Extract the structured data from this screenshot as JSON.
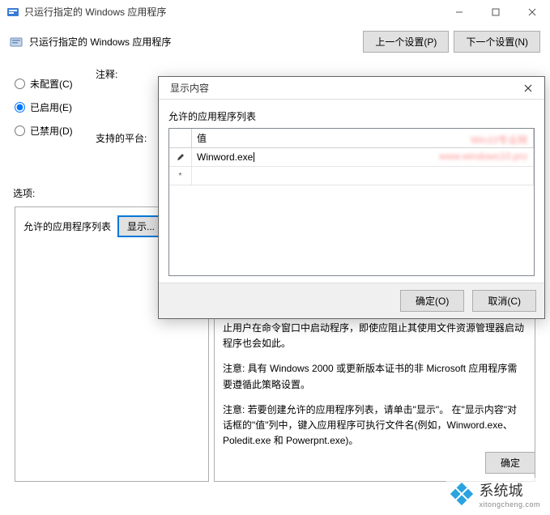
{
  "window": {
    "title": "只运行指定的 Windows 应用程序",
    "header_title": "只运行指定的 Windows 应用程序",
    "prev_btn": "上一个设置(P)",
    "next_btn": "下一个设置(N)"
  },
  "radios": {
    "not_configured": "未配置(C)",
    "enabled": "已启用(E)",
    "disabled": "已禁用(D)"
  },
  "labels": {
    "comment": "注释:",
    "platforms": "支持的平台:",
    "options": "选项:"
  },
  "left_pane": {
    "row_label": "允许的应用程序列表",
    "show_btn": "显示..."
  },
  "right_pane": {
    "p1": "止用户在命令窗口中启动程序，即使应阻止其使用文件资源管理器启动程序也会如此。",
    "p2": "注意: 具有 Windows 2000 或更新版本证书的非 Microsoft 应用程序需要遵循此策略设置。",
    "p3": "注意: 若要创建允许的应用程序列表，请单击\"显示\"。 在\"显示内容\"对话框的\"值\"列中，键入应用程序可执行文件名(例如，Winword.exe、Poledit.exe 和 Powerpnt.exe)。"
  },
  "footer": {
    "ok": "确定"
  },
  "dialog": {
    "title": "显示内容",
    "list_label": "允许的应用程序列表",
    "col_value": "值",
    "row1_value": "Winword.exe",
    "ok": "确定(O)",
    "cancel": "取消(C)",
    "watermark1": "Win10专业网",
    "watermark2": "www.windows10.pro"
  },
  "branding": {
    "name": "系统城",
    "url": "xitongcheng.com"
  },
  "icons": {
    "app": "app-icon",
    "minimize": "minimize-icon",
    "maximize": "maximize-icon",
    "close": "close-icon",
    "edit_row": "pencil-icon",
    "new_row": "asterisk-icon"
  }
}
